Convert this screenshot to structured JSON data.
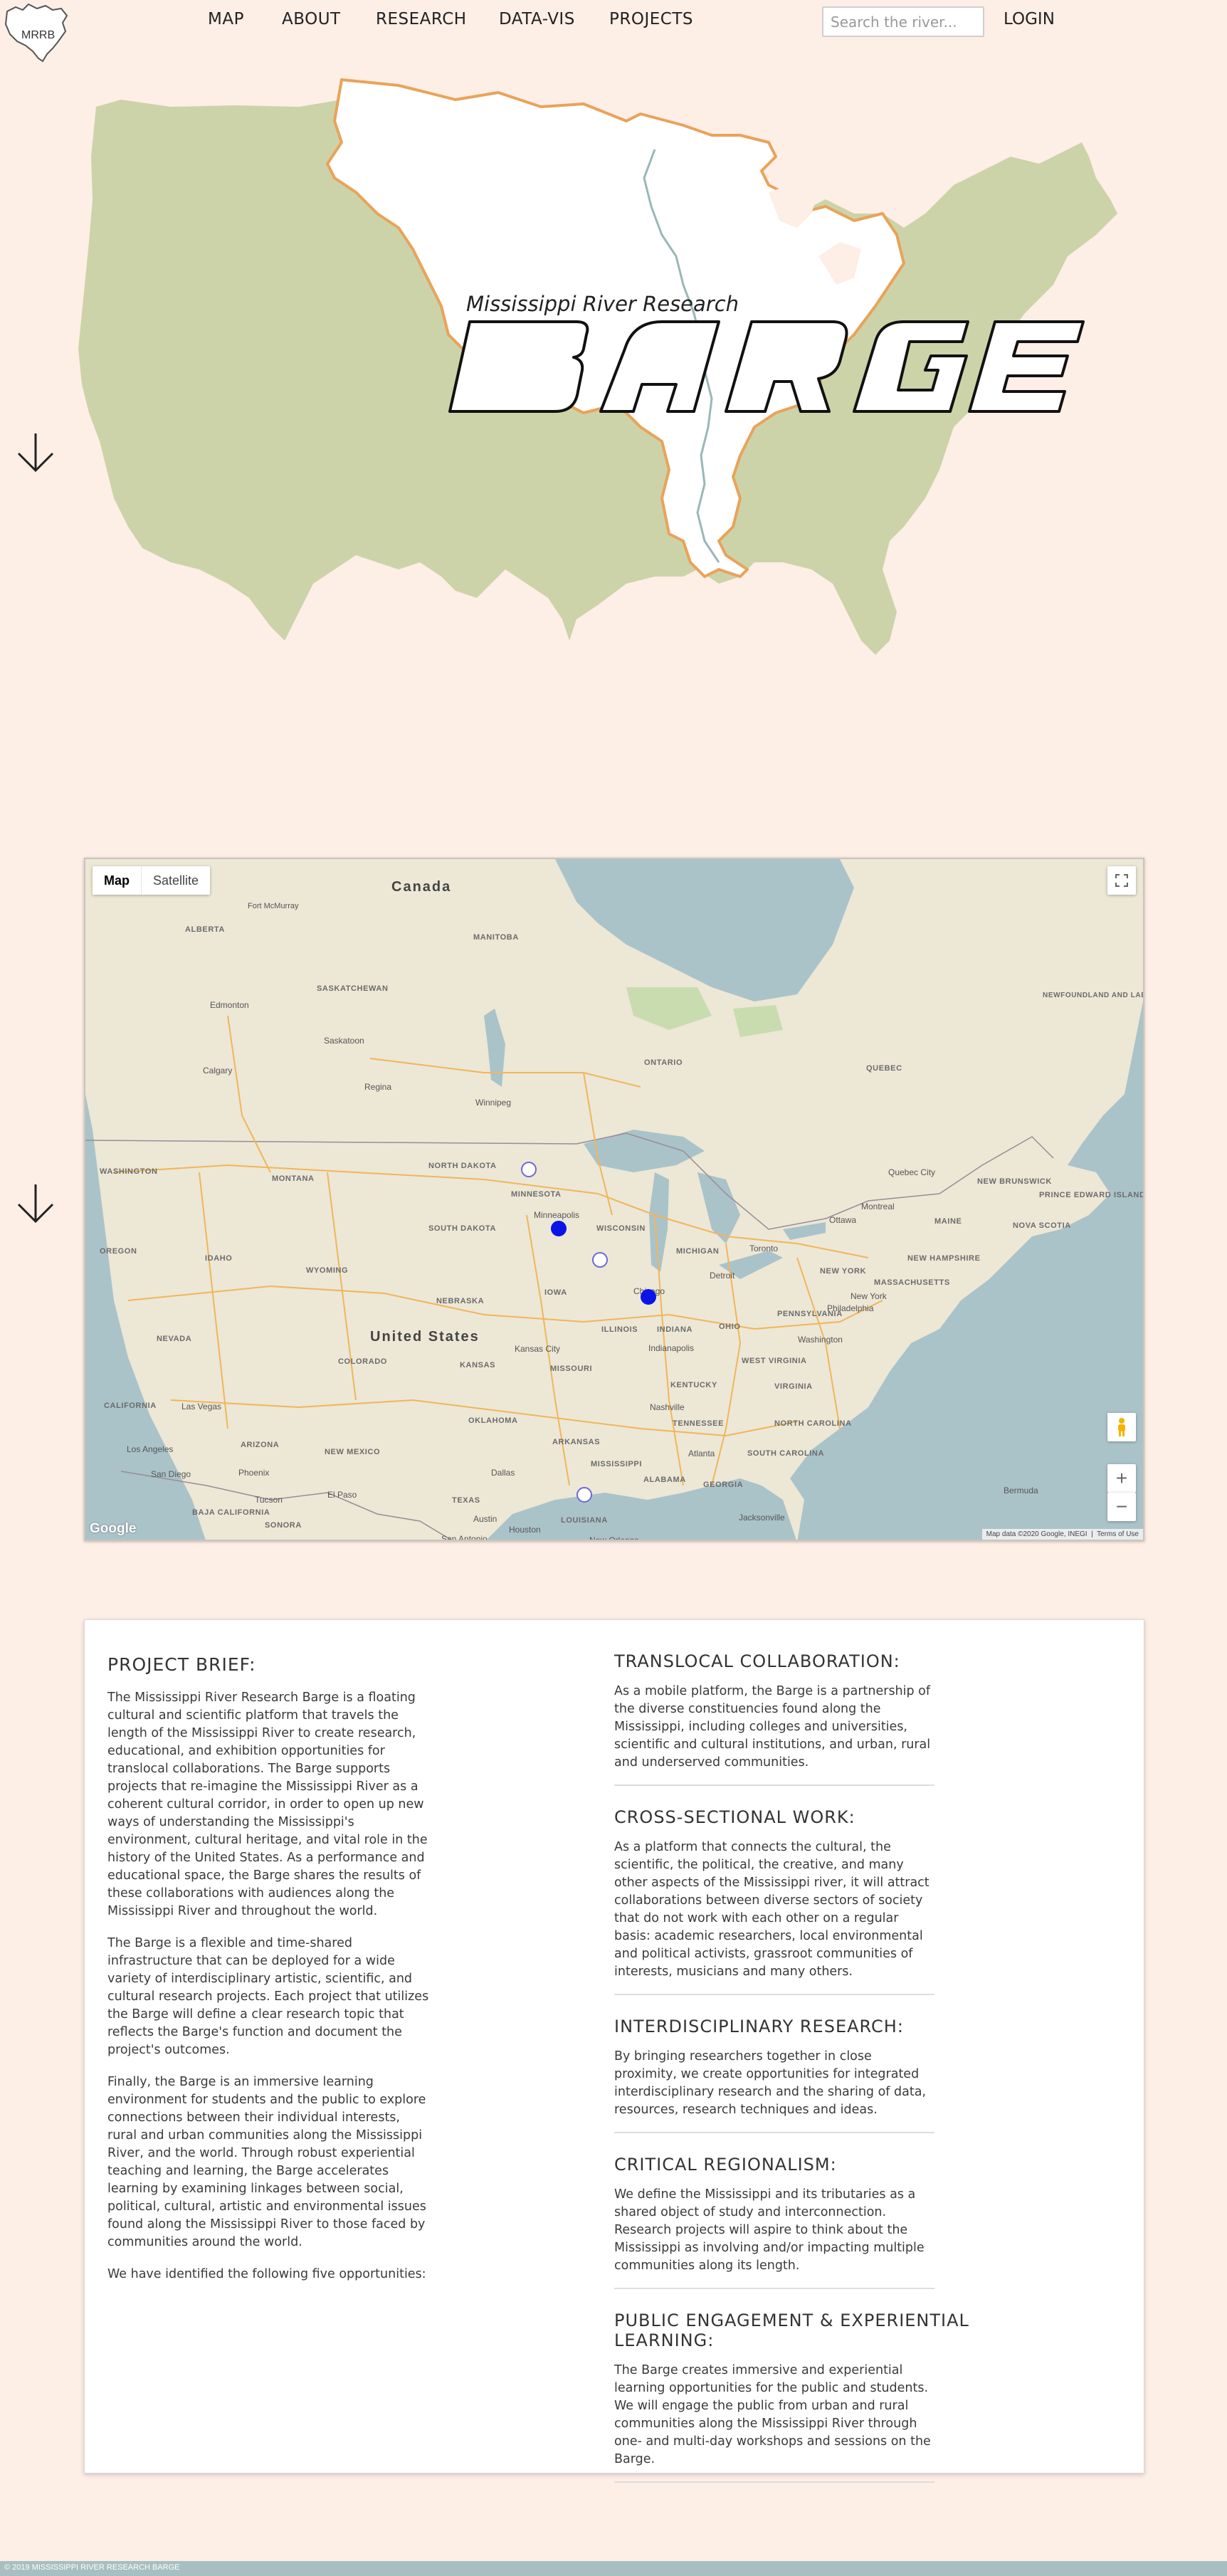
{
  "logo": {
    "text": "MRRB"
  },
  "nav": {
    "items": [
      "MAP",
      "ABOUT",
      "RESEARCH",
      "DATA-VIS",
      "PROJECTS"
    ],
    "search_placeholder": "Search the river...",
    "login": "LOGIN"
  },
  "hero": {
    "subtitle": "Mississippi River Research",
    "wordmark": "BARGE",
    "colors": {
      "land": "#cdd3a8",
      "basin": "#ffffff",
      "basin_border": "#e8a35a",
      "river": "#9ab7b6"
    }
  },
  "map": {
    "toggle": {
      "map": "Map",
      "satellite": "Satellite"
    },
    "countries": [
      "Canada",
      "United States"
    ],
    "states": [
      "ALBERTA",
      "MANITOBA",
      "SASKATCHEWAN",
      "ONTARIO",
      "QUEBEC",
      "NEWFOUNDLAND AND LABRADOR",
      "WASHINGTON",
      "MONTANA",
      "NORTH DAKOTA",
      "MINNESOTA",
      "SOUTH DAKOTA",
      "WISCONSIN",
      "MICHIGAN",
      "OREGON",
      "IDAHO",
      "WYOMING",
      "NEBRASKA",
      "IOWA",
      "ILLINOIS",
      "INDIANA",
      "OHIO",
      "PENNSYLVANIA",
      "NEW YORK",
      "NEVADA",
      "COLORADO",
      "KANSAS",
      "MISSOURI",
      "KENTUCKY",
      "VIRGINIA",
      "WEST VIRGINIA",
      "CALIFORNIA",
      "ARIZONA",
      "NEW MEXICO",
      "OKLAHOMA",
      "TENNESSEE",
      "NORTH CAROLINA",
      "SOUTH CAROLINA",
      "ARKANSAS",
      "MISSISSIPPI",
      "ALABAMA",
      "GEORGIA",
      "TEXAS",
      "LOUISIANA",
      "BAJA CALIFORNIA",
      "SONORA",
      "MAINE",
      "MASSACHUSETTS",
      "NEW BRUNSWICK",
      "PRINCE EDWARD ISLAND",
      "NOVA SCOTIA",
      "NEW HAMPSHIRE"
    ],
    "cities": [
      "Edmonton",
      "Calgary",
      "Saskatoon",
      "Regina",
      "Winnipeg",
      "Minneapolis",
      "Chicago",
      "Detroit",
      "Toronto",
      "Ottawa",
      "Montreal",
      "Quebec City",
      "Philadelphia",
      "New York",
      "Washington",
      "Indianapolis",
      "Kansas City",
      "Nashville",
      "Atlanta",
      "Dallas",
      "Houston",
      "Austin",
      "San Antonio",
      "El Paso",
      "Tucson",
      "Phoenix",
      "Las Vegas",
      "Los Angeles",
      "San Diego",
      "New Orleans",
      "Jacksonville",
      "Bermuda",
      "Fort McMurray"
    ],
    "google": "Google",
    "attribution": "Map data ©2020 Google, INEGI",
    "terms": "Terms of Use",
    "marker_color": "#0b14e8"
  },
  "brief": {
    "title": "PROJECT BRIEF:",
    "paragraphs": [
      "The Mississippi River Research Barge is a floating cultural and scientific platform that travels the length of the Mississippi River to create research, educational, and exhibition opportunities for translocal collaborations. The Barge supports projects that re-imagine the Mississippi River as a coherent cultural corridor, in order to open up new ways of understanding the Mississippi's environment, cultural heritage, and vital role in the history of the United States. As a performance and educational space, the Barge shares the results of these collaborations with audiences along the Mississippi River and throughout the world.",
      "The Barge is a flexible and time-shared infrastructure that can be deployed for a wide variety of interdisciplinary artistic, scientific, and cultural research projects. Each project that utilizes the Barge will define a clear research topic that reflects the Barge's function and document the project's outcomes.",
      "Finally, the Barge is an immersive learning environment for students and the public to explore connections between their individual interests, rural and urban communities along the Mississippi River, and the world. Through robust experiential teaching and learning, the Barge accelerates learning by examining linkages between social, political, cultural, artistic and environmental issues found along the Mississippi River to those faced by communities around the world.",
      "We have identified the following five opportunities:"
    ]
  },
  "opportunities": [
    {
      "title": "TRANSLOCAL COLLABORATION:",
      "text": "As a mobile platform, the Barge is a partnership of the diverse constituencies found along the Mississippi, including colleges and universities, scientific and cultural institutions, and urban, rural and underserved communities."
    },
    {
      "title": "CROSS-SECTIONAL WORK:",
      "text": "As a platform that connects the cultural, the scientific, the political, the creative, and many other aspects of the Mississippi river, it will attract collaborations between diverse sectors of society that do not work with each other on a regular basis: academic researchers, local environmental and political activists, grassroot communities of interests, musicians and many others."
    },
    {
      "title": "INTERDISCIPLINARY RESEARCH:",
      "text": "By bringing researchers together in close proximity, we create opportunities for integrated interdisciplinary research and the sharing of data, resources, research techniques and ideas."
    },
    {
      "title": "CRITICAL REGIONALISM:",
      "text": "We define the Mississippi and its tributaries as a shared object of study and interconnection. Research projects will aspire to think about the Mississippi as involving and/or impacting multiple communities along its length."
    },
    {
      "title": "PUBLIC ENGAGEMENT & EXPERIENTIAL LEARNING:",
      "text": "The Barge creates immersive and experiential learning opportunities for the public and students. We will engage the public from urban and rural communities along the Mississippi River through one- and multi-day workshops and sessions on the Barge."
    }
  ],
  "footer": {
    "text": "© 2019 MISSISSIPPI RIVER RESEARCH BARGE"
  }
}
